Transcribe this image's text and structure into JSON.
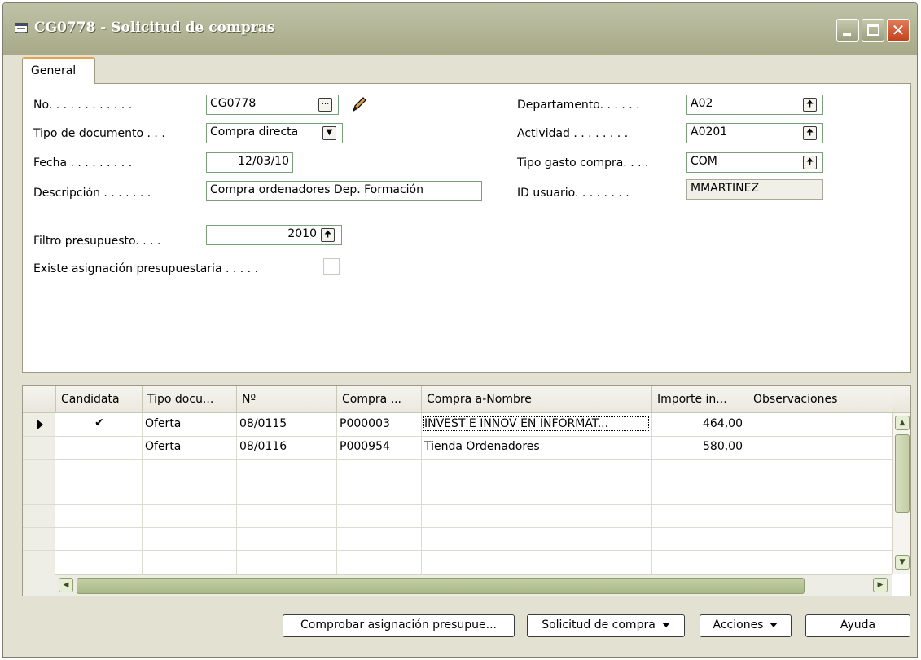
{
  "window": {
    "title": "CG0778 - Solicitud de compras",
    "close_glyph": "✕"
  },
  "tabs": [
    {
      "label": "General",
      "active": true
    }
  ],
  "form": {
    "no_label": "No. . . . . . . . . . . .",
    "no_value": "CG0778",
    "tipo_doc_label": "Tipo de documento . . .",
    "tipo_doc_value": "Compra directa",
    "fecha_label": "Fecha . . . . . . . . .",
    "fecha_value": "12/03/10",
    "descripcion_label": "Descripción . . . . . . .",
    "descripcion_value": "Compra ordenadores Dep. Formación",
    "filtro_label": "Filtro presupuesto. . . .",
    "filtro_value": "2010",
    "asignacion_label": "Existe asignación presupuestaria . . . . .",
    "asignacion_checked": false,
    "departamento_label": "Departamento. . . . . .",
    "departamento_value": "A02",
    "actividad_label": "Actividad . . . . . . . .",
    "actividad_value": "A0201",
    "tipo_gasto_label": "Tipo gasto compra. . . .",
    "tipo_gasto_value": "COM",
    "usuario_label": "ID usuario. . . . . . . .",
    "usuario_value": "MMARTINEZ",
    "lookup_glyph": "...",
    "dropdown_glyph": "▼",
    "up_glyph": "🠉"
  },
  "lines": {
    "columns": [
      "Candidata",
      "Tipo docu...",
      "Nº",
      "Compra ...",
      "Compra a-Nombre",
      "Importe in...",
      "Observaciones"
    ],
    "rows": [
      {
        "candidata": "✔",
        "tipo": "Oferta",
        "no": "08/0115",
        "compra": "P000003",
        "nombre": "INVEST E INNOV EN INFORMAT...",
        "importe": "464,00",
        "obs": ""
      },
      {
        "candidata": "",
        "tipo": "Oferta",
        "no": "08/0116",
        "compra": "P000954",
        "nombre": "Tienda Ordenadores",
        "importe": "580,00",
        "obs": ""
      }
    ],
    "selected_row": 0
  },
  "buttons": {
    "comprobar": "Comprobar asignación presupue...",
    "solicitud": "Solicitud de compra",
    "acciones": "Acciones",
    "ayuda": "Ayuda"
  },
  "icons": [
    "window-icon",
    "minimize-icon",
    "maximize-icon",
    "close-icon",
    "lookup-icon",
    "pencil-icon",
    "dropdown-icon",
    "lookup-arrow-icon",
    "row-pointer-icon",
    "scroll-up-icon",
    "scroll-down-icon",
    "scroll-left-icon",
    "scroll-right-icon"
  ],
  "colors": {
    "titlebar": "#a7aa88",
    "tab_accent": "#e8a44a",
    "field_border": "#7aa07a",
    "close_button": "#c4421b"
  }
}
